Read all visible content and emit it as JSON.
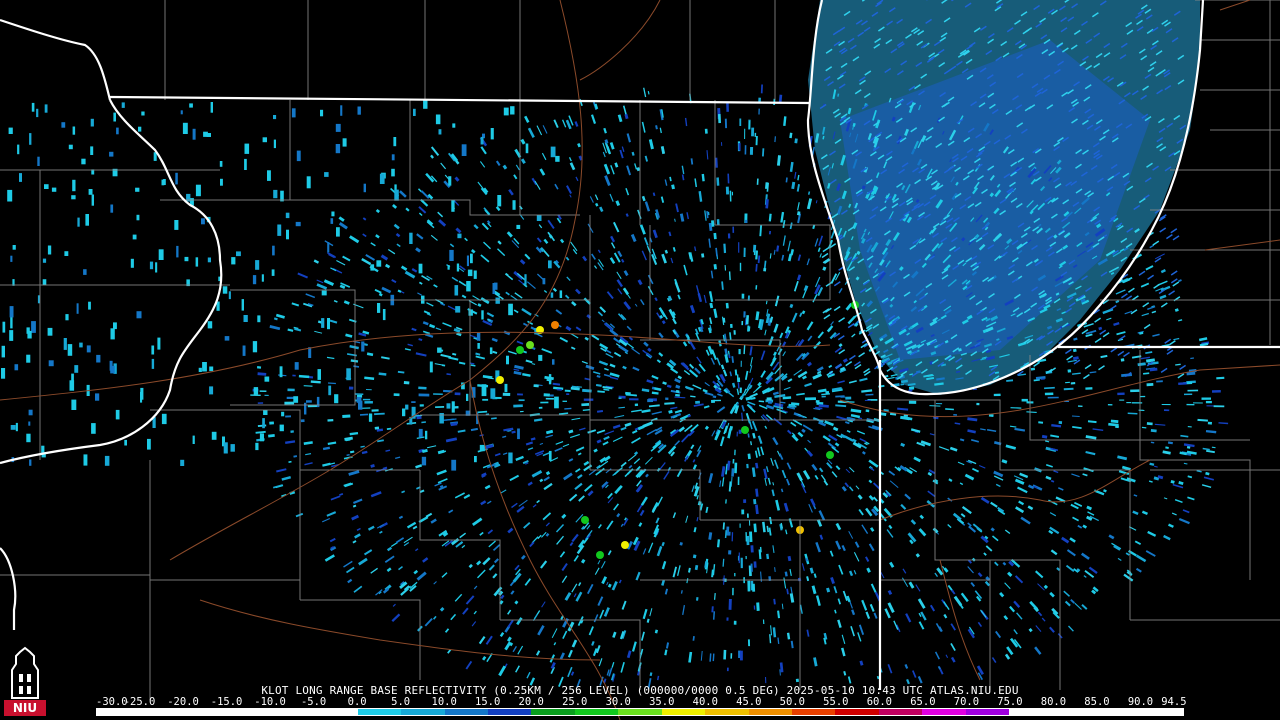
{
  "product": {
    "caption": "KLOT LONG RANGE BASE REFLECTIVITY (0.25KM / 256 LEVEL) (000000/0000 0.5 DEG) 2025-05-10 10:43 UTC  ATLAS.NIU.EDU"
  },
  "logo": {
    "text": "NIU",
    "color": "#c8102e"
  },
  "scale": {
    "labels": [
      "-30.0",
      "-25.0",
      "-20.0",
      "-15.0",
      "-10.0",
      "-5.0",
      "0.0",
      "5.0",
      "10.0",
      "15.0",
      "20.0",
      "25.0",
      "30.0",
      "35.0",
      "40.0",
      "45.0",
      "50.0",
      "55.0",
      "60.0",
      "65.0",
      "70.0",
      "75.0",
      "80.0",
      "85.0",
      "90.0",
      "94.5"
    ],
    "colors": [
      "#ffffff",
      "#ffffff",
      "#ffffff",
      "#ffffff",
      "#ffffff",
      "#ffffff",
      "#1ecbe6",
      "#17a9d6",
      "#1477c8",
      "#1340c0",
      "#0a9e1e",
      "#12c81e",
      "#6ae01e",
      "#f0f000",
      "#f0c000",
      "#f09000",
      "#e84000",
      "#d00000",
      "#c00060",
      "#e000e0",
      "#a000e0",
      "#ffffff",
      "#ffffff",
      "#ffffff",
      "#ffffff"
    ]
  },
  "map": {
    "background": "#000000",
    "state_border_color": "#ffffff",
    "county_line_color": "#8a8a8a",
    "road_color": "#8b4a2a",
    "radar_site": "KLOT"
  }
}
